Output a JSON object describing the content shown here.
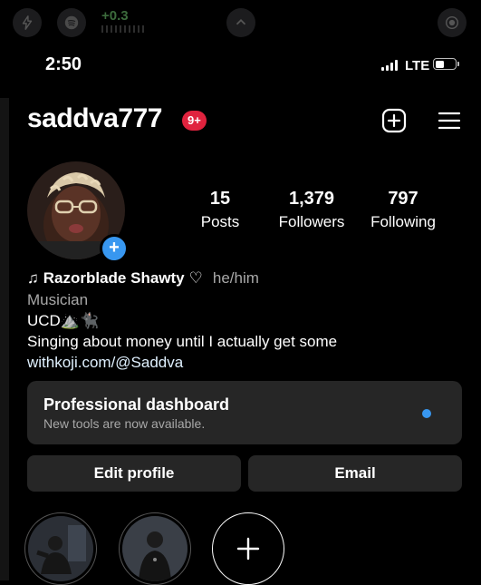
{
  "status_bar": {
    "time": "2:50",
    "network": "LTE",
    "top_readout": "+0.3"
  },
  "header": {
    "username": "saddva777",
    "notification_badge": "9+"
  },
  "stats": [
    {
      "number": "15",
      "label": "Posts"
    },
    {
      "number": "1,379",
      "label": "Followers"
    },
    {
      "number": "797",
      "label": "Following"
    }
  ],
  "bio": {
    "note_glyph": "♫",
    "display_name": "Razorblade Shawty",
    "heart": "♡",
    "pronouns": "he/him",
    "category": "Musician",
    "line1": "UCD⛰️🐈‍⬛",
    "line2": "Singing about money until I actually get some",
    "link": "withkoji.com/@Saddva"
  },
  "dashboard": {
    "title": "Professional dashboard",
    "subtitle": "New tools are now available."
  },
  "buttons": {
    "edit_profile": "Edit profile",
    "email": "Email"
  },
  "colors": {
    "accent_blue": "#3897f0",
    "badge_red": "#e0233e",
    "card_bg": "#262626"
  },
  "icons": {
    "create": "plus-square-icon",
    "menu": "hamburger-menu-icon",
    "add_story": "plus-icon"
  }
}
